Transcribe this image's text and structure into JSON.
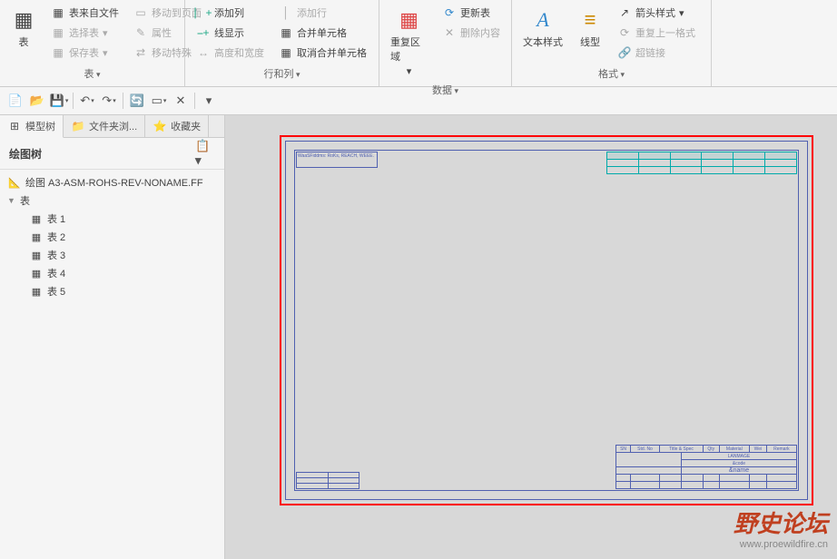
{
  "ribbon": {
    "groups": {
      "table": {
        "label": "表",
        "big": "表",
        "items": [
          "表来自文件",
          "移动到页面",
          "选择表",
          "属性",
          "保存表",
          "移动特殊"
        ]
      },
      "rowcol": {
        "label": "行和列",
        "items": [
          "添加列",
          "线显示",
          "添加行",
          "合并单元格",
          "高度和宽度",
          "取消合并单元格"
        ]
      },
      "data": {
        "label": "数据",
        "big1": "重复区域",
        "items": [
          "更新表",
          "删除内容"
        ]
      },
      "format": {
        "label": "格式",
        "big1": "文本样式",
        "big2": "线型",
        "items": [
          "箭头样式",
          "重复上一格式",
          "超链接"
        ]
      }
    }
  },
  "tabs": {
    "model": "模型树",
    "folder": "文件夹浏...",
    "fav": "收藏夹"
  },
  "tree": {
    "header": "绘图树",
    "root": "绘图 A3-ASM-ROHS-REV-NONAME.FF",
    "tableNode": "表",
    "tables": [
      "表 1",
      "表 2",
      "表 3",
      "表 4",
      "表 5"
    ]
  },
  "drawing": {
    "note_tl": "WaaSFiddms: RoKs, REACH, WEEE."
  },
  "title_block": {
    "headers": [
      "SN",
      "Std. No",
      "Title & Spec",
      "Qty",
      "Material",
      "Wei",
      "Remark"
    ],
    "company": "LANMAGE",
    "code": "&code",
    "name": "&name"
  },
  "watermark": {
    "logo": "野史论坛",
    "url": "www.proewildfire.cn"
  }
}
